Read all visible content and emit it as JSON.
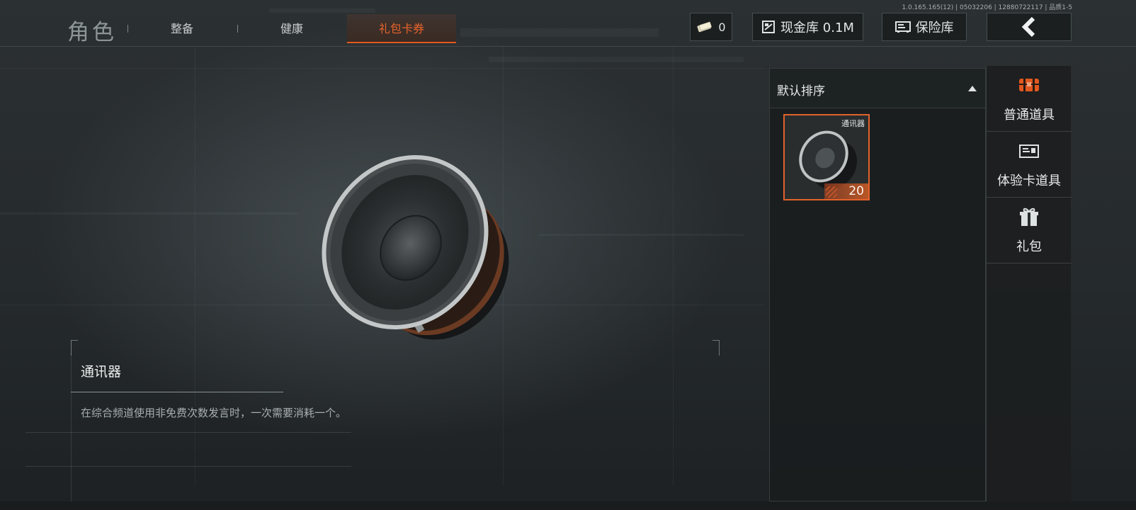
{
  "header": {
    "title": "角色",
    "tabs": [
      {
        "label": "整备",
        "active": false
      },
      {
        "label": "健康",
        "active": false
      },
      {
        "label": "礼包卡券",
        "active": true
      }
    ],
    "version_text": "1.0.165.165(12) | 05032206 | 12880722117 | 品质1-5",
    "cash_count": "0",
    "cash_vault_label": "现金库 0.1M",
    "safe_label": "保险库",
    "accent_color": "#e0581f"
  },
  "item_detail": {
    "name": "通讯器",
    "description": "在综合频道使用非免费次数发言时，一次需要消耗一个。"
  },
  "items_panel": {
    "sort_label": "默认排序",
    "items": [
      {
        "name": "通讯器",
        "count": "20",
        "selected": true,
        "icon": "speaker-icon"
      }
    ]
  },
  "categories": [
    {
      "label": "普通道具",
      "icon": "chest-icon",
      "active": true
    },
    {
      "label": "体验卡道具",
      "icon": "id-card-icon",
      "active": false
    },
    {
      "label": "礼包",
      "icon": "gift-icon",
      "active": false
    }
  ]
}
